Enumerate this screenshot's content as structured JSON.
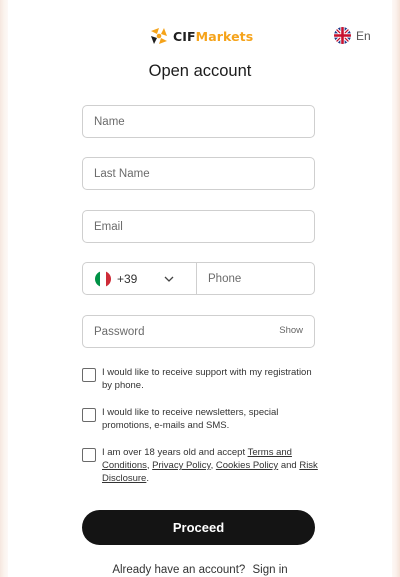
{
  "header": {
    "logo_prefix": "CIF",
    "logo_suffix": "Markets",
    "language": "En",
    "language_flag": "uk-flag-icon"
  },
  "form": {
    "title": "Open account",
    "name_placeholder": "Name",
    "last_name_placeholder": "Last Name",
    "email_placeholder": "Email",
    "country_code": "+39",
    "country_flag": "italy-flag-icon",
    "phone_placeholder": "Phone",
    "password_placeholder": "Password",
    "show_label": "Show"
  },
  "consents": {
    "support": "I would like to receive support with my registration by phone.",
    "newsletter": "I would like to receive newsletters, special promotions, e-mails and SMS.",
    "terms_prefix": "I am over 18 years old and accept ",
    "terms_link": "Terms and Conditions",
    "sep1": ", ",
    "privacy_link": "Privacy Policy",
    "sep2": ", ",
    "cookies_link": "Cookies Policy",
    "sep3": " and ",
    "risk_link": "Risk Disclosure",
    "terms_end": "."
  },
  "actions": {
    "proceed_label": "Proceed",
    "account_prompt": "Already have an account?",
    "signin_label": "Sign in"
  },
  "colors": {
    "brand_orange": "#f5a31a",
    "button_dark": "#141414"
  }
}
